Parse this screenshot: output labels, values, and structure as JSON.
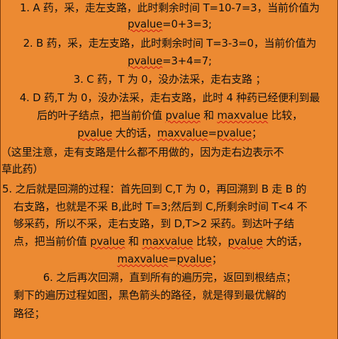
{
  "paragraphs": [
    {
      "lines": [
        [
          "1. A 药，采，走左支路，此时剩余时间 T=10-7=3，当前价值为"
        ],
        [
          "pvalue",
          "=0+3=3;"
        ]
      ]
    },
    {
      "lines": [
        [
          "2. B 药，采，走左支路，此时剩余时间 T=3-3=0，当前价值为"
        ],
        [
          "pvalue",
          "=3+4=7;"
        ]
      ]
    },
    {
      "lines": [
        [
          "3. C 药，T 为 0，没办法采，走右支路                 ；"
        ]
      ]
    },
    {
      "lines": [
        [
          "4. D 药,T 为 0，没办法采，走右支路，此时 4 种药已经便利到最"
        ],
        [
          "后的叶子结点，把当前价值 ",
          "pvalue",
          " 和 ",
          "maxvalue",
          " 比较，"
        ],
        [
          "pvalue",
          " 大的话，",
          "maxvalue",
          "=",
          "pvalue",
          "；"
        ]
      ]
    },
    {
      "lines": [
        [
          "（这里注意，走有支路是什么都不用做的，因为走右边表示不"
        ],
        [
          "草此药）"
        ]
      ]
    },
    {
      "lines": [
        [
          "5. 之后就是回溯的过程：首先回到 C,T 为 0，再回溯到 B 走 B 的"
        ],
        [
          "右支路，也就是不采 B,此时 T=3;然后到 C,所剩余时间 T<4 不"
        ],
        [
          "够采药，所以不采，走右支路，到 D,T>2 采药。到达叶子结"
        ],
        [
          "点，把当前价值 ",
          "pvalue",
          " 和 ",
          "maxvalue",
          " 比较，",
          "pvalue",
          " 大的话，"
        ],
        [
          "maxvalue",
          "=",
          "pvalue",
          "；"
        ]
      ]
    },
    {
      "lines": [
        [
          "6. 之后再次回溯，直到所有的遍历完，返回到根结点；"
        ],
        [
          "剩下的遍历过程如图，黑色箭头的路径，就是得到最优解的"
        ],
        [
          "路径；"
        ]
      ]
    }
  ]
}
